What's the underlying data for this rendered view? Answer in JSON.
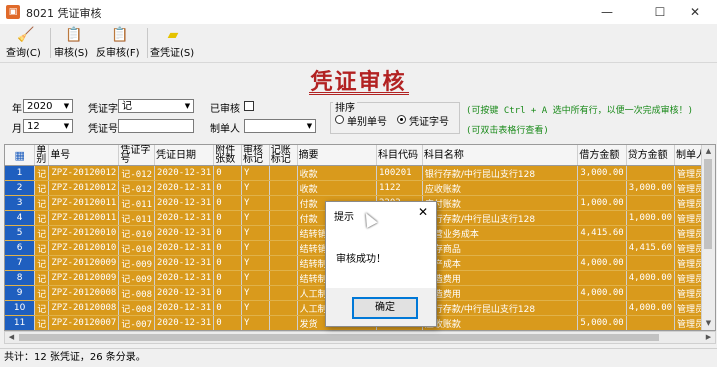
{
  "window": {
    "title": "8021 凭证审核",
    "minimize": "—",
    "maximize": "☐",
    "close": "✕"
  },
  "toolbar": {
    "query": "查询(C)",
    "audit": "审核(S)",
    "unaudit": "反审核(F)",
    "view_voucher": "查凭证(S)"
  },
  "heading": "凭证审核",
  "filters": {
    "year_label": "年",
    "year_value": "2020",
    "month_label": "月",
    "month_value": "12",
    "voucher_word_label": "凭证字",
    "voucher_word_value": "记",
    "voucher_no_label": "凭证号",
    "audited_label": "已审核",
    "maker_label": "制单人",
    "sort_label": "排序",
    "sort_option1": "单别单号",
    "sort_option2": "凭证字号",
    "hint1": "(可按键 Ctrl + A 选中所有行，以便一次完成审核！)",
    "hint2": "(可双击表格行查看)"
  },
  "columns": [
    "单别",
    "单号",
    "凭证字号",
    "凭证日期",
    "附件张数",
    "审核标记",
    "记账标记",
    "摘要",
    "科目代码",
    "科目名称",
    "借方金额",
    "贷方金额",
    "制单人"
  ],
  "rows": [
    {
      "n": "1",
      "t": "记",
      "no": "ZPZ-20120012",
      "vw": "记-012",
      "d": "2020-12-31",
      "att": "0",
      "au": "Y",
      "bk": "",
      "memo": "收款",
      "code": "100201",
      "name": "银行存款/中行昆山支行128",
      "dr": "3,000.00",
      "cr": "",
      "mk": "管理员"
    },
    {
      "n": "2",
      "t": "记",
      "no": "ZPZ-20120012",
      "vw": "记-012",
      "d": "2020-12-31",
      "att": "0",
      "au": "Y",
      "bk": "",
      "memo": "收款",
      "code": "1122",
      "name": "应收账款",
      "dr": "",
      "cr": "3,000.00",
      "mk": "管理员"
    },
    {
      "n": "3",
      "t": "记",
      "no": "ZPZ-20120011",
      "vw": "记-011",
      "d": "2020-12-31",
      "att": "0",
      "au": "Y",
      "bk": "",
      "memo": "付款",
      "code": "2202",
      "name": "应付账款",
      "dr": "1,000.00",
      "cr": "",
      "mk": "管理员"
    },
    {
      "n": "4",
      "t": "记",
      "no": "ZPZ-20120011",
      "vw": "记-011",
      "d": "2020-12-31",
      "att": "0",
      "au": "Y",
      "bk": "",
      "memo": "付款",
      "code": "100201",
      "name": "银行存款/中行昆山支行128",
      "dr": "",
      "cr": "1,000.00",
      "mk": "管理员"
    },
    {
      "n": "5",
      "t": "记",
      "no": "ZPZ-20120010",
      "vw": "记-010",
      "d": "2020-12-31",
      "att": "0",
      "au": "Y",
      "bk": "",
      "memo": "结转销售",
      "code": "6401",
      "name": "主营业务成本",
      "dr": "4,415.60",
      "cr": "",
      "mk": "管理员"
    },
    {
      "n": "6",
      "t": "记",
      "no": "ZPZ-20120010",
      "vw": "记-010",
      "d": "2020-12-31",
      "att": "0",
      "au": "Y",
      "bk": "",
      "memo": "结转销售",
      "code": "1405",
      "name": "库存商品",
      "dr": "",
      "cr": "4,415.60",
      "mk": "管理员"
    },
    {
      "n": "7",
      "t": "记",
      "no": "ZPZ-20120009",
      "vw": "记-009",
      "d": "2020-12-31",
      "att": "0",
      "au": "Y",
      "bk": "",
      "memo": "结转制费",
      "code": "5001",
      "name": "生产成本",
      "dr": "4,000.00",
      "cr": "",
      "mk": "管理员"
    },
    {
      "n": "8",
      "t": "记",
      "no": "ZPZ-20120009",
      "vw": "记-009",
      "d": "2020-12-31",
      "att": "0",
      "au": "Y",
      "bk": "",
      "memo": "结转制费",
      "code": "5101",
      "name": "制造费用",
      "dr": "",
      "cr": "4,000.00",
      "mk": "管理员"
    },
    {
      "n": "9",
      "t": "记",
      "no": "ZPZ-20120008",
      "vw": "记-008",
      "d": "2020-12-31",
      "att": "0",
      "au": "Y",
      "bk": "",
      "memo": "人工制费",
      "code": "5101",
      "name": "制造费用",
      "dr": "4,000.00",
      "cr": "",
      "mk": "管理员"
    },
    {
      "n": "10",
      "t": "记",
      "no": "ZPZ-20120008",
      "vw": "记-008",
      "d": "2020-12-31",
      "att": "0",
      "au": "Y",
      "bk": "",
      "memo": "人工制费",
      "code": "100201",
      "name": "银行存款/中行昆山支行128",
      "dr": "",
      "cr": "4,000.00",
      "mk": "管理员"
    },
    {
      "n": "11",
      "t": "记",
      "no": "ZPZ-20120007",
      "vw": "记-007",
      "d": "2020-12-31",
      "att": "0",
      "au": "Y",
      "bk": "",
      "memo": "发货",
      "code": "1122",
      "name": "应收账款",
      "dr": "5,000.00",
      "cr": "",
      "mk": "管理员"
    }
  ],
  "status": "共计：12 张凭证，26 条分录。",
  "dialog": {
    "title": "提示",
    "close": "✕",
    "message": "审核成功！",
    "ok": "确定"
  }
}
